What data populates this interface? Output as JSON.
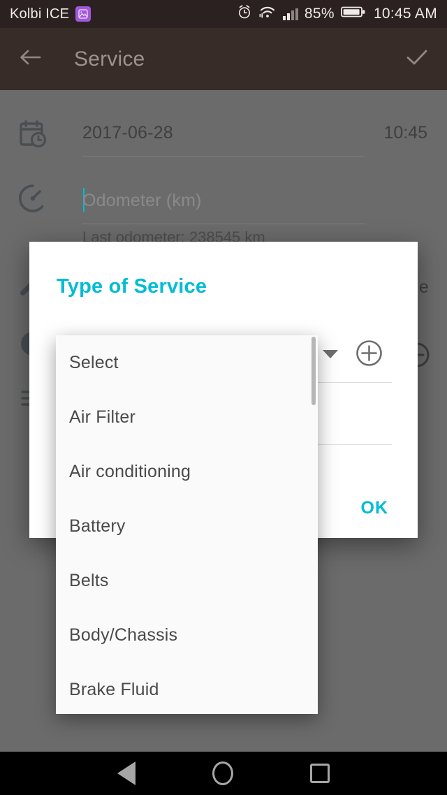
{
  "status_bar": {
    "carrier": "Kolbi ICE",
    "badge_icon": "screenshot-badge-icon",
    "alarm_icon": "alarm-icon",
    "wifi_icon": "wifi-icon",
    "signal_icon": "signal-bars-icon",
    "battery_percent": "85%",
    "battery_icon": "battery-icon",
    "time": "10:45 AM"
  },
  "app_bar": {
    "back_icon": "back-arrow-icon",
    "title": "Service",
    "confirm_icon": "check-icon"
  },
  "form": {
    "date_icon": "calendar-clock-icon",
    "date": "2017-06-28",
    "time": "10:45",
    "odometer_icon": "speedometer-icon",
    "odometer_placeholder": "Odometer (km)",
    "odometer_value": "",
    "last_odometer": "Last odometer: 238545 km",
    "service_icon": "wrench-icon",
    "cost_icon": "coin-icon",
    "notes_icon": "list-icon",
    "partial_label": "e",
    "minus_icon": "circle-minus-icon"
  },
  "dialog": {
    "title": "Type of Service",
    "spinner_arrow_icon": "chevron-down-icon",
    "add_icon": "circle-plus-icon",
    "ok_label": "OK"
  },
  "dropdown": {
    "scrollbar": "vertical-scrollbar",
    "items": [
      {
        "label": "Select"
      },
      {
        "label": "Air Filter"
      },
      {
        "label": "Air conditioning"
      },
      {
        "label": "Battery"
      },
      {
        "label": "Belts"
      },
      {
        "label": "Body/Chassis"
      },
      {
        "label": "Brake Fluid"
      }
    ]
  },
  "nav_bar": {
    "back_icon": "nav-back-icon",
    "home_icon": "nav-home-icon",
    "recents_icon": "nav-recents-icon"
  },
  "colors": {
    "accent": "#00BCD4",
    "status_bar_bg": "#2B2120",
    "app_bar_bg": "#382C28",
    "scrim": "#6B6B6B"
  }
}
